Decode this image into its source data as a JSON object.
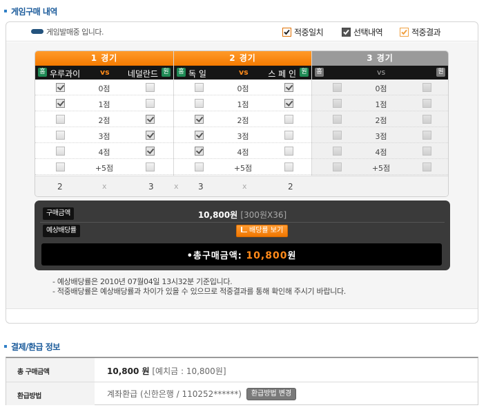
{
  "section1": {
    "title": "게임구매 내역"
  },
  "status": {
    "text": "게임발매중 입니다."
  },
  "legend": [
    {
      "label": "적중일치",
      "color": "#e07000",
      "checked": true
    },
    {
      "label": "선택내역",
      "color": "#555555",
      "checked": true
    },
    {
      "label": "적중결과",
      "color": "#f0a040",
      "checked": true
    }
  ],
  "games": [
    {
      "header": "1 경기",
      "home_badge": "홈",
      "home": "우루과이",
      "vs": "vs",
      "away": "네덜란드",
      "away_badge": "원",
      "rows": [
        {
          "label": "0점",
          "home": true,
          "away": false
        },
        {
          "label": "1점",
          "home": true,
          "away": false
        },
        {
          "label": "2점",
          "home": false,
          "away": true
        },
        {
          "label": "3점",
          "home": false,
          "away": true
        },
        {
          "label": "4점",
          "home": false,
          "away": true
        },
        {
          "label": "+5점",
          "home": false,
          "away": false
        }
      ],
      "count_home": "2",
      "count_sep": "x",
      "count_away": "3"
    },
    {
      "header": "2 경기",
      "home_badge": "홈",
      "home": "독 일",
      "vs": "vs",
      "away": "스 페 인",
      "away_badge": "원",
      "rows": [
        {
          "label": "0점",
          "home": false,
          "away": true
        },
        {
          "label": "1점",
          "home": false,
          "away": true
        },
        {
          "label": "2점",
          "home": true,
          "away": false
        },
        {
          "label": "3점",
          "home": true,
          "away": false
        },
        {
          "label": "4점",
          "home": true,
          "away": false
        },
        {
          "label": "+5점",
          "home": false,
          "away": false
        }
      ],
      "count_home": "3",
      "count_sep": "x",
      "count_away": "2"
    },
    {
      "header": "3 경기",
      "home_badge": "홈",
      "home": "",
      "vs": "vs",
      "away": "",
      "away_badge": "원",
      "rows": [
        {
          "label": "0점",
          "home": false,
          "away": false
        },
        {
          "label": "1점",
          "home": false,
          "away": false
        },
        {
          "label": "2점",
          "home": false,
          "away": false
        },
        {
          "label": "3점",
          "home": false,
          "away": false
        },
        {
          "label": "4점",
          "home": false,
          "away": false
        },
        {
          "label": "+5점",
          "home": false,
          "away": false
        }
      ],
      "count_home": "",
      "count_sep": "",
      "count_away": ""
    }
  ],
  "between_sep": "x",
  "purchase": {
    "amount_tag": "구매금액",
    "amount": "10,800원",
    "amount_detail": "[300원X36]",
    "odds_tag": "예상배당률",
    "odds_button": "배당률 보기",
    "total_label": "•총구매금액:",
    "total_value": "10,800",
    "total_unit": "원"
  },
  "notes": [
    "- 예상배당률은 2010년 07월04일 13시32분 기준입니다.",
    "- 적중배당률은 예상배당률과 차이가 있을 수 있으므로 적중결과를 통해 확인해 주시기 바랍니다."
  ],
  "section2": {
    "title": "결제/환급 정보"
  },
  "payment": {
    "total_label": "총 구매금액",
    "total_value": "10,800 원",
    "deposit_text": "[예치금 : 10,800원]",
    "refund_label": "환급방법",
    "refund_value": "계좌환급 (신한은행 / 110252******)",
    "change_button": "환급방법 변경"
  }
}
